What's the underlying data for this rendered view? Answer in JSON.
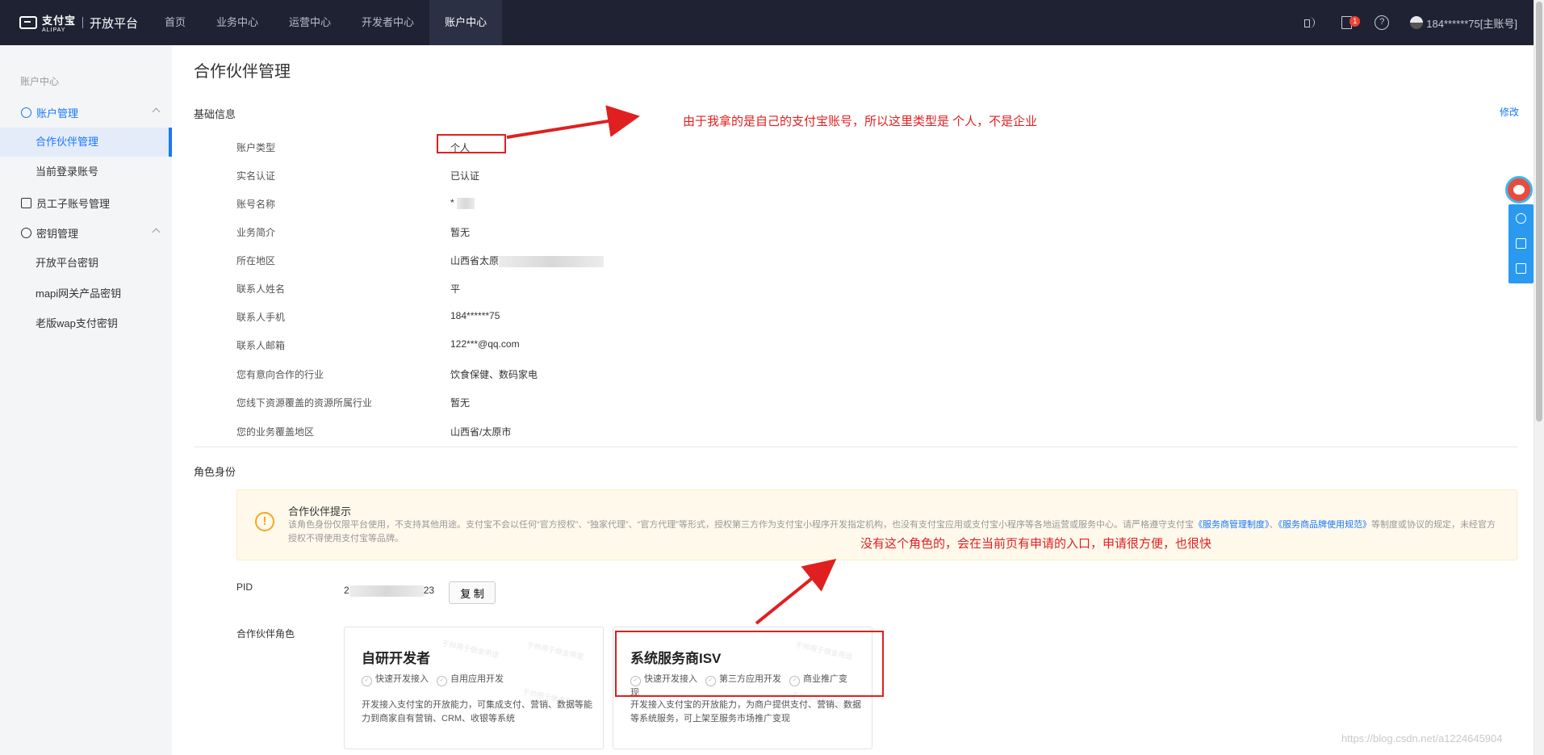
{
  "topbar": {
    "logo_brand": "支付宝",
    "logo_sub": "ALIPAY",
    "logo_title": "开放平台",
    "nav": [
      "首页",
      "业务中心",
      "运营中心",
      "开发者中心",
      "账户中心"
    ],
    "badge_count": "1",
    "help_glyph": "?",
    "user": "184******75[主账号]"
  },
  "sidebar": {
    "title": "账户中心",
    "group_account": "账户管理",
    "item_partner": "合作伙伴管理",
    "item_login": "当前登录账号",
    "group_staff": "员工子账号管理",
    "group_key": "密钥管理",
    "item_open_key": "开放平台密钥",
    "item_mapi": "mapi网关产品密钥",
    "item_wap": "老版wap支付密钥"
  },
  "main": {
    "page_title": "合作伙伴管理",
    "basic_title": "基础信息",
    "edit": "修改",
    "info": [
      {
        "k": "账户类型",
        "v": "个人"
      },
      {
        "k": "实名认证",
        "v": "已认证"
      },
      {
        "k": "账号名称",
        "v": "*   "
      },
      {
        "k": "业务简介",
        "v": "暂无"
      },
      {
        "k": "所在地区",
        "v": "山西省太原"
      },
      {
        "k": "联系人姓名",
        "v": "   平"
      },
      {
        "k": "联系人手机",
        "v": "184******75"
      },
      {
        "k": "联系人邮箱",
        "v": "122***@qq.com"
      },
      {
        "k": "您有意向合作的行业",
        "v": "饮食保健、数码家电"
      },
      {
        "k": "您线下资源覆盖的资源所属行业",
        "v": "暂无"
      },
      {
        "k": "您的业务覆盖地区",
        "v": "山西省/太原市"
      }
    ],
    "role_title": "角色身份",
    "alert": {
      "icon": "!",
      "title": "合作伙伴提示",
      "body_1": "该角色身份仅限平台使用，不支持其他用途。支付宝不会以任何“官方授权”、“独家代理”、“官方代理”等形式，授权第三方作为支付宝小程序开发指定机构，也没有支付宝应用或支付宝小程序等各地运营或服务中心。请严格遵守支付宝",
      "link_1": "《服务商管理制度》",
      "body_2": "、",
      "link_2": "《服务商品牌使用规范》",
      "body_3": "等制度或协议的规定，未经官方授权不得使用支付宝等品牌。"
    },
    "pid_label": "PID",
    "pid_prefix": "2",
    "pid_suffix": "23",
    "copy_label": "复 制",
    "roles_label": "合作伙伴角色",
    "cards": [
      {
        "title": "自研开发者",
        "tags": [
          "快速开发接入",
          "自用应用开发"
        ],
        "desc": "开发接入支付宝的开放能力，可集成支付、营销、数据等能力到商家自有营销、CRM、收银等系统"
      },
      {
        "title": "系统服务商ISV",
        "tags": [
          "快速开发接入",
          "第三方应用开发",
          "商业推广变现"
        ],
        "desc": "开发接入支付宝的开放能力，为商户提供支付、营销、数据等系统服务，可上架至服务市场推广变现"
      }
    ],
    "watermark": "于帅用于做金用途"
  },
  "annotations": {
    "note_top": "由于我拿的是自己的支付宝账号，所以这里类型是 个人，不是企业",
    "note_bottom": "没有这个角色的，会在当前页有申请的入口，申请很方便，也很快",
    "color": "#e02020"
  },
  "url_watermark": "https://blog.csdn.net/a1224645904"
}
